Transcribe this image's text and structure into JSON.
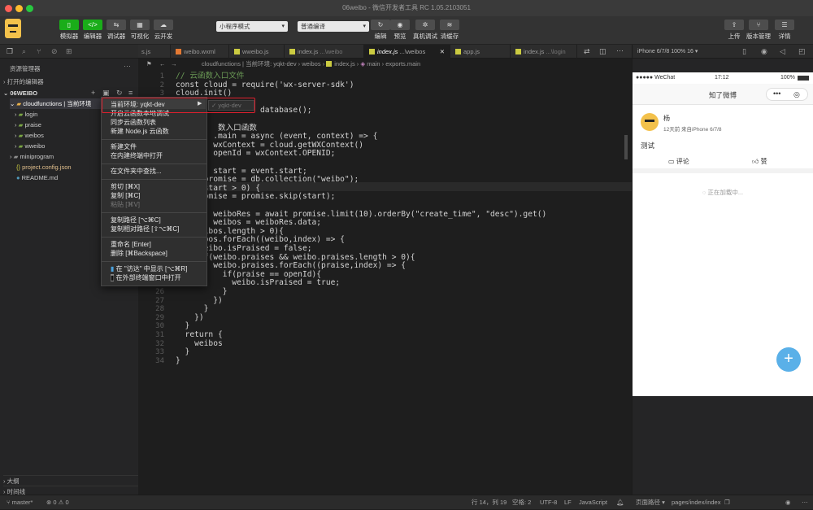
{
  "window_title": "06weibo - 微信开发者工具 RC 1.05.2103051",
  "toolbar": {
    "simulator": "模拟器",
    "editor": "编辑器",
    "debugger": "调试器",
    "visual": "可视化",
    "cloud": "云开发",
    "mode": "小程序模式",
    "compile_mode": "普通编译",
    "compile": "编辑",
    "preview": "预览",
    "real_debug": "真机调试",
    "clear_cache": "清缓存",
    "upload": "上传",
    "version": "版本管理",
    "details": "详情"
  },
  "sidebar": {
    "title": "资源管理器",
    "open_editors": "打开的编辑器",
    "project": "06WEIBO",
    "tree": [
      {
        "label": "cloudfunctions | 当前环境",
        "kind": "folder-open"
      },
      {
        "label": "login",
        "kind": "folder"
      },
      {
        "label": "praise",
        "kind": "folder"
      },
      {
        "label": "weibos",
        "kind": "folder"
      },
      {
        "label": "wweibo",
        "kind": "folder"
      },
      {
        "label": "miniprogram",
        "kind": "folder"
      },
      {
        "label": "project.config.json",
        "kind": "json"
      },
      {
        "label": "README.md",
        "kind": "md"
      }
    ],
    "outline": "大纲",
    "timeline": "时间线"
  },
  "tabs": [
    {
      "name": "s.js",
      "hint": ""
    },
    {
      "name": "weibo.wxml",
      "hint": ""
    },
    {
      "name": "wweibo.js",
      "hint": ""
    },
    {
      "name": "index.js",
      "hint": "...\\weibo"
    },
    {
      "name": "index.js",
      "hint": "...\\weibos"
    },
    {
      "name": "app.js",
      "hint": ""
    },
    {
      "name": "index.js",
      "hint": "...\\login"
    }
  ],
  "breadcrumb": {
    "path": "cloudfunctions | 当前环境: yqkt-dev › weibos › ",
    "file": "index.js",
    "seg1": "main",
    "seg2": "exports.main"
  },
  "code_lines": [
    {
      "n": "1",
      "t": "// 云函数入口文件"
    },
    {
      "n": "2",
      "t": "const cloud = require('wx-server-sdk')"
    },
    {
      "n": "3",
      "t": "cloud.init()"
    },
    {
      "n": "4",
      "t": ""
    },
    {
      "n": "5",
      "t": "                  database();"
    },
    {
      "n": "6",
      "t": ""
    },
    {
      "n": "7",
      "t": "         数入口函数"
    },
    {
      "n": "8",
      "t": "        .main = async (event, context) => {"
    },
    {
      "n": "9",
      "t": "        wxContext = cloud.getWXContext()"
    },
    {
      "n": "10",
      "t": "        openId = wxContext.OPENID;"
    },
    {
      "n": "11",
      "t": ""
    },
    {
      "n": "12",
      "t": "        start = event.start;"
    },
    {
      "n": "13",
      "t": "      promise = db.collection(\"weibo\");"
    },
    {
      "n": "14",
      "t": "      start > 0) {"
    },
    {
      "n": "15",
      "t": "      omise = promise.skip(start);"
    },
    {
      "n": "16",
      "t": ""
    },
    {
      "n": "17",
      "t": "        weiboRes = await promise.limit(10).orderBy(\"create_time\", \"desc\").get()"
    },
    {
      "n": "18",
      "t": "        weibos = weiboRes.data;"
    },
    {
      "n": "19",
      "t": "      ibos.length > 0){"
    },
    {
      "n": "20",
      "t": "      bos.forEach((weibo,index) => {"
    },
    {
      "n": "21",
      "t": "      eibo.isPraised = false;"
    },
    {
      "n": "22",
      "t": "      f(weibo.praises && weibo.praises.length > 0){"
    },
    {
      "n": "23",
      "t": "        weibo.praises.forEach((praise,index) => {"
    },
    {
      "n": "24",
      "t": "          if(praise == openId){"
    },
    {
      "n": "25",
      "t": "            weibo.isPraised = true;"
    },
    {
      "n": "26",
      "t": "          }"
    },
    {
      "n": "27",
      "t": "        })"
    },
    {
      "n": "28",
      "t": "      }"
    },
    {
      "n": "29",
      "t": "    })"
    },
    {
      "n": "30",
      "t": "  }"
    },
    {
      "n": "31",
      "t": "  return {"
    },
    {
      "n": "32",
      "t": "    weibos"
    },
    {
      "n": "33",
      "t": "  }"
    },
    {
      "n": "34",
      "t": "}"
    }
  ],
  "context_menu": {
    "current_env": "当前环境: yqkt-dev",
    "submenu_env": "✓ yqkt-dev",
    "items": [
      "开启云函数本地调试",
      "同步云函数列表",
      "新建 Node.js 云函数",
      "新建文件",
      "在内建终端中打开",
      "在文件夹中查找...",
      "剪切 [⌘X]",
      "复制 [⌘C]",
      "粘贴 [⌘V]",
      "复制路径 [⌥⌘C]",
      "复制相对路径 [⇧⌥⌘C]",
      "重命名 [Enter]",
      "删除 [⌘Backspace]",
      "在 \"访达\" 中显示 [⌥⌘R]",
      "在外部终端窗口中打开"
    ]
  },
  "simulator": {
    "device": "iPhone 6/7/8 100% 16 ▾",
    "carrier": "●●●●● WeChat",
    "time": "17:12",
    "battery": "100%",
    "nav_title": "知了微博",
    "post": {
      "user": "杨",
      "meta": "12天前  来自iPhone 6/7/8",
      "content": "测试",
      "comment": "评论",
      "like": "赞"
    },
    "loading": "正在加载中...",
    "fab": "+"
  },
  "status": {
    "branch": "master*",
    "errors": "0",
    "warnings": "0",
    "position": "行 14，列 19",
    "spaces": "空格: 2",
    "encoding": "UTF-8",
    "eol": "LF",
    "language": "JavaScript",
    "page_path_label": "页面路径 ▾",
    "page_path": "pages/index/index"
  }
}
